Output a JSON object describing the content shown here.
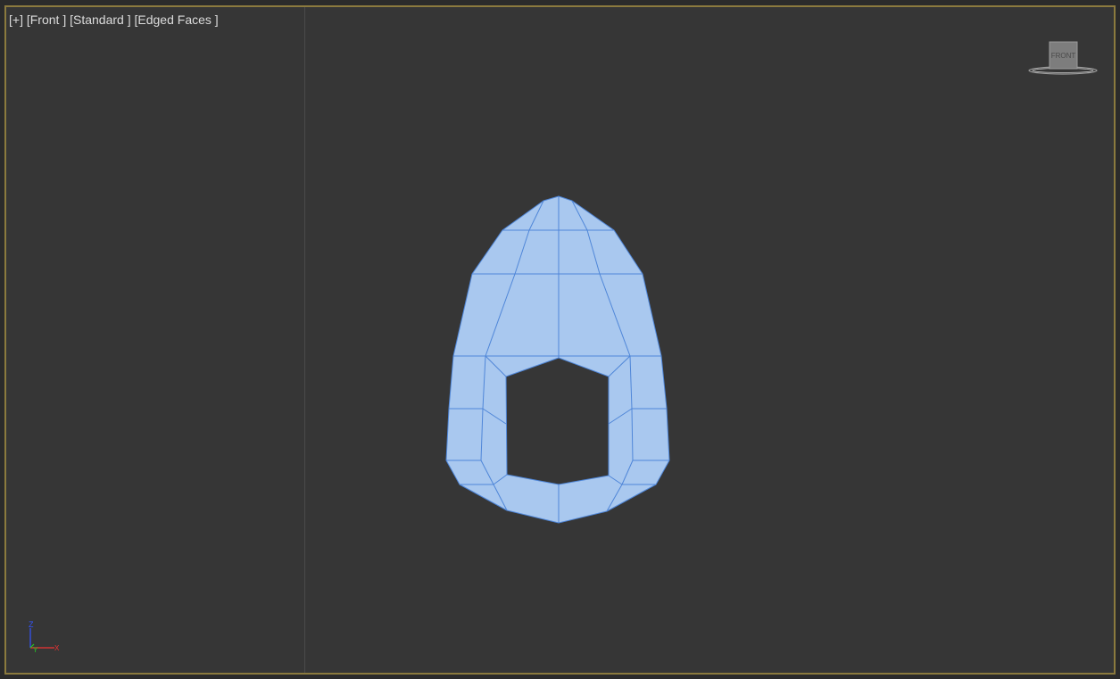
{
  "viewport": {
    "label_plus": "[+]",
    "label_view": "[Front ]",
    "label_shading": "[Standard ]",
    "label_mode": "[Edged Faces ]",
    "border_color": "#8b7a3e",
    "background_color": "#363636"
  },
  "viewcube": {
    "face_label": "FRONT",
    "icon": "viewcube-icon"
  },
  "axis_tripod": {
    "z_label": "Z",
    "y_label": "Y",
    "x_label": "X",
    "z_color": "#3355ff",
    "y_color": "#22cc22",
    "x_color": "#ee3333"
  },
  "mesh": {
    "fill_color": "#a9c8ef",
    "edge_color": "#4f86d8"
  }
}
